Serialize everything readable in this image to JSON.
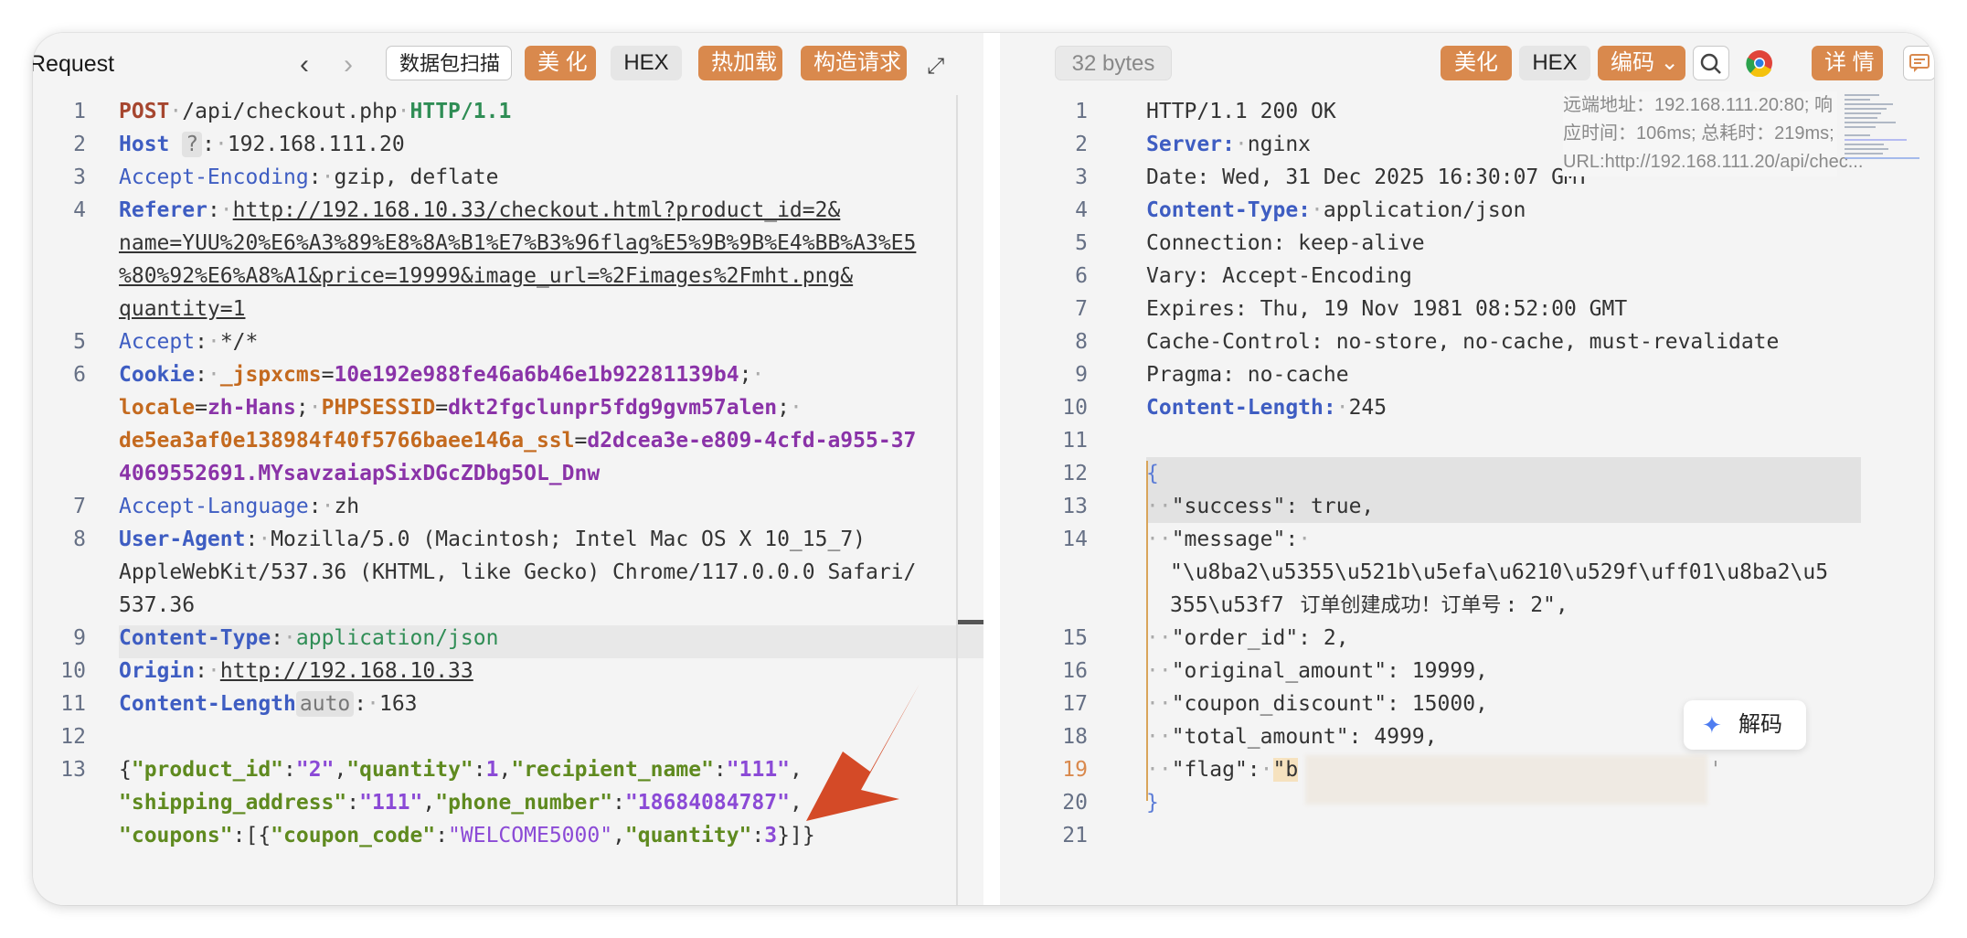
{
  "request": {
    "title": "Request",
    "toolbar": {
      "scan_label": "数据包扫描",
      "beautify_label": "美 化",
      "hex_label": "HEX",
      "hotload_label": "热加载",
      "construct_label": "构造请求"
    },
    "lines": [
      {
        "n": "1"
      },
      {
        "n": "2"
      },
      {
        "n": "3"
      },
      {
        "n": "4"
      },
      {
        "n": "5"
      },
      {
        "n": "6"
      },
      {
        "n": "7"
      },
      {
        "n": "8"
      },
      {
        "n": "9"
      },
      {
        "n": "10"
      },
      {
        "n": "11"
      },
      {
        "n": "12"
      },
      {
        "n": "13"
      }
    ],
    "text": {
      "method": "POST",
      "path": "/api/checkout.php",
      "protocol": "HTTP/1.1",
      "host_key": "Host",
      "host_badge": "?",
      "host_val": "192.168.111.20",
      "ae_key": "Accept-Encoding",
      "ae_val": "gzip, deflate",
      "referer_key": "Referer",
      "referer_1": "http://192.168.10.33/checkout.html?product_id=2&",
      "referer_2": "name=YUU%20%E6%A3%89%E8%8A%B1%E7%B3%96flag%E5%9B%9B%E4%BB%A3%E5",
      "referer_3": "%80%92%E6%A8%A1&price=19999&image_url=%2Fimages%2Fmht.png&",
      "referer_4": "quantity=1",
      "accept_key": "Accept",
      "accept_val": "*/*",
      "cookie_key": "Cookie",
      "c1_k": "_jspxcms",
      "c1_v": "10e192e988fe46a6b46e1b92281139b4",
      "c2_k": "locale",
      "c2_v": "zh-Hans",
      "c3_k": "PHPSESSID",
      "c3_v": "dkt2fgclunpr5fdg9gvm57alen",
      "c4_k": "de5ea3af0e138984f40f5766baee146a_ssl",
      "c4_v1": "d2dcea3e-e809-4cfd-a955-37",
      "c4_v2": "4069552691.MYsavzaiapSixDGcZDbg5OL_Dnw",
      "al_key": "Accept-Language",
      "al_val": "zh",
      "ua_key": "User-Agent",
      "ua_1": "Mozilla/5.0 (Macintosh; Intel Mac OS X 10_15_7)",
      "ua_2": "AppleWebKit/537.36 (KHTML, like Gecko) Chrome/117.0.0.0 Safari/",
      "ua_3": "537.36",
      "ct_key": "Content-Type",
      "ct_val": "application/json",
      "origin_key": "Origin",
      "origin_val": "http://192.168.10.33",
      "cl_key": "Content-Length",
      "cl_badge": "auto",
      "cl_val": "163",
      "b_k1": "\"product_id\"",
      "b_v1": "\"2\"",
      "b_k2": "\"quantity\"",
      "b_v2": "1",
      "b_k3": "\"recipient_name\"",
      "b_v3": "\"111\"",
      "b_k4": "\"shipping_address\"",
      "b_v4": "\"111\"",
      "b_k5": "\"phone_number\"",
      "b_v5": "\"18684084787\"",
      "b_k6": "\"coupons\"",
      "b_k7": "\"coupon_code\"",
      "b_v7": "\"WELCOME5000\"",
      "b_k8": "\"quantity\"",
      "b_v8": "3"
    }
  },
  "response": {
    "bytes_label": "32 bytes",
    "toolbar": {
      "beautify_label": "美化",
      "hex_label": "HEX",
      "encoding_label": "编码",
      "detail_label": "详 情"
    },
    "lines": [
      {
        "n": "1"
      },
      {
        "n": "2"
      },
      {
        "n": "3"
      },
      {
        "n": "4"
      },
      {
        "n": "5"
      },
      {
        "n": "6"
      },
      {
        "n": "7"
      },
      {
        "n": "8"
      },
      {
        "n": "9"
      },
      {
        "n": "10"
      },
      {
        "n": "11"
      },
      {
        "n": "12"
      },
      {
        "n": "13"
      },
      {
        "n": "14"
      },
      {
        "n": "15"
      },
      {
        "n": "16"
      },
      {
        "n": "17"
      },
      {
        "n": "18"
      },
      {
        "n": "19"
      },
      {
        "n": "20"
      },
      {
        "n": "21"
      }
    ],
    "text": {
      "status": "HTTP/1.1 200 OK",
      "server_key": "Server:",
      "server_val": "nginx",
      "date": "Date: Wed, 31 Dec 2025 16:30:07 GMT",
      "ct_key": "Content-Type:",
      "ct_val": "application/json",
      "conn": "Connection: keep-alive",
      "vary": "Vary: Accept-Encoding",
      "expires": "Expires: Thu, 19 Nov 1981 08:52:00 GMT",
      "cache": "Cache-Control: no-store, no-cache, must-revalidate",
      "pragma": "Pragma: no-cache",
      "cl_key": "Content-Length:",
      "cl_val": "245",
      "open_brace": "{",
      "success": "\"success\": true,",
      "message_key": "\"message\":",
      "message_1": "\"\\u8ba2\\u5355\\u521b\\u5efa\\u6210\\u529f\\uff01\\u8ba2\\u5",
      "message_2": "355\\u53f7",
      "message_tip": "订单创建成功！订单号",
      "message_end": ": 2\",",
      "order_id": "\"order_id\": 2,",
      "original": "\"original_amount\": 19999,",
      "coupon": "\"coupon_discount\": 15000,",
      "total": "\"total_amount\": 4999,",
      "flag_key": "\"flag\":",
      "flag_val": "\"b",
      "close_brace": "}"
    },
    "tooltip": "远端地址：192.168.111.20:80; 响应时间：106ms; 总耗时：219ms; URL:http://192.168.111.20/api/chec...",
    "decode_label": "解码"
  },
  "colors": {
    "accent_orange": "#d9894d",
    "arrow_red": "#d44a27",
    "header_key_blue": "#3e5dc2"
  }
}
